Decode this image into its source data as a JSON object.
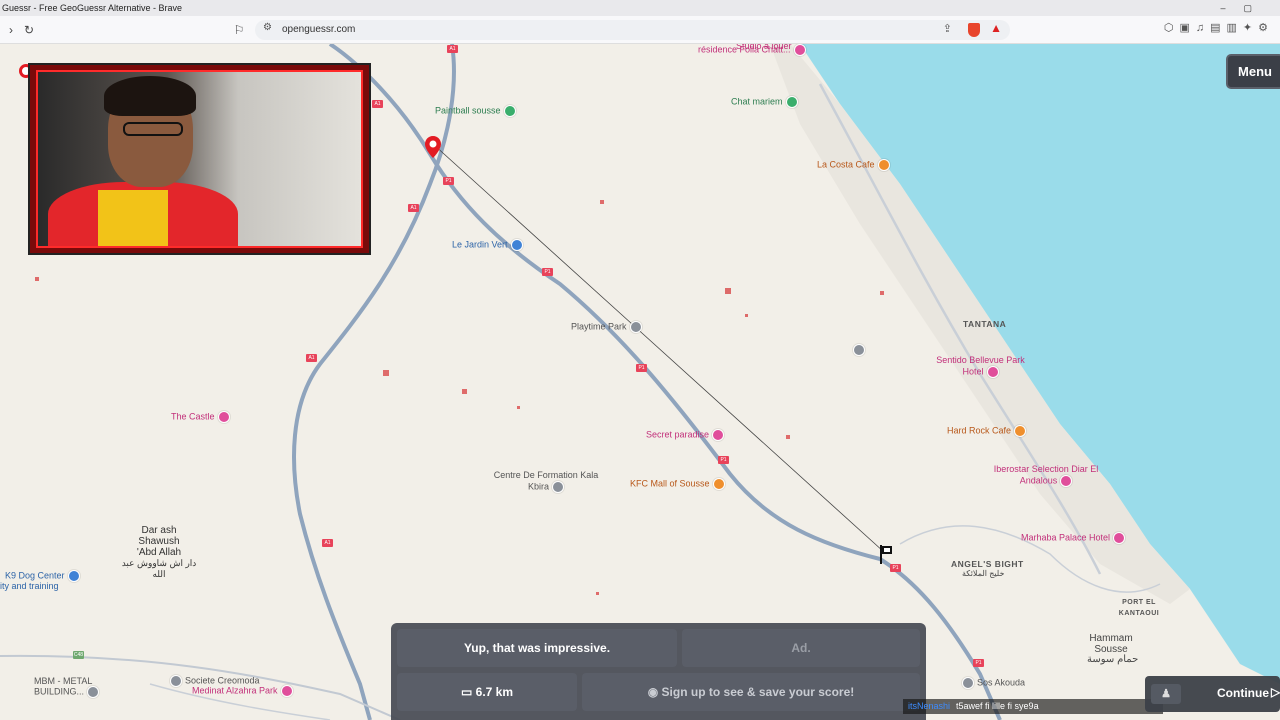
{
  "browser": {
    "window_title": "Guessr - Free GeoGuessr Alternative - Brave",
    "url": "openguessr.com"
  },
  "map": {
    "pois": [
      {
        "label": "résidence Folla Chatt...",
        "color": "pink"
      },
      {
        "label": "Paintball sousse",
        "color": "green"
      },
      {
        "label": "Chat mariem",
        "color": "green"
      },
      {
        "label": "La Costa Cafe",
        "color": "orange"
      },
      {
        "label": "Le Jardin Vert",
        "color": "blue"
      },
      {
        "label": "Playtime Park",
        "color": "grey"
      },
      {
        "label": "Sentido Bellevue Park Hotel",
        "color": "pink"
      },
      {
        "label": "The Castle",
        "color": "pink"
      },
      {
        "label": "Hard Rock Cafe",
        "color": "orange"
      },
      {
        "label": "Secret paradise",
        "color": "pink"
      },
      {
        "label": "Iberostar Selection Diar El Andalous",
        "color": "pink"
      },
      {
        "label": "Centre De Formation Kala Kbira",
        "color": "grey"
      },
      {
        "label": "KFC Mall of Sousse",
        "color": "orange"
      },
      {
        "label": "Marhaba Palace Hotel",
        "color": "pink"
      },
      {
        "label": "K9 Dog Center",
        "color": "blue"
      },
      {
        "label": "MBM - METAL BUILDING...",
        "color": "grey"
      },
      {
        "label": "Societe Creomoda",
        "color": "grey"
      },
      {
        "label": "Medinat Alzahra Park",
        "color": "pink"
      },
      {
        "label": "Sos Akouda",
        "color": "grey"
      }
    ],
    "places": {
      "tantana": "TANTANA",
      "angels_bight": "ANGEL'S BIGHT",
      "angels_bight_ar": "خليج الملائكة",
      "port_el_kantaoui": "PORT EL KANTAOUI",
      "hammam_sousse": "Hammam Sousse",
      "hammam_sousse_ar": "حمام سوسة",
      "dar_ash": "Dar ash Shawush 'Abd Allah",
      "dar_ash_ar": "دار اش شاووش عبد الله",
      "k9_sub": "ity and training",
      "studio_top": "Studio à louer"
    },
    "road_labels": [
      "A1",
      "P1",
      "C48"
    ]
  },
  "ui": {
    "menu_label": "Menu",
    "result_message": "Yup, that was impressive.",
    "ad_label": "Ad.",
    "distance": "6.7 km",
    "signup_label": "Sign up to see & save your score!",
    "continue_label": "Continue",
    "chat": {
      "user": "itsNenashi",
      "message": "t5awef fi lille fi sye9a"
    }
  },
  "colors": {
    "water": "#9adcea",
    "road": "#8fa4bd",
    "land": "#f2efe8",
    "accent_red": "#e31b23"
  }
}
